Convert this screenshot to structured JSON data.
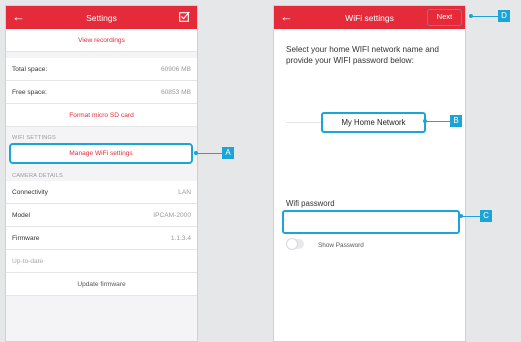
{
  "settings_screen": {
    "title": "Settings",
    "view_recordings": "View recordings",
    "total_space_label": "Total space:",
    "total_space_value": "60906 MB",
    "free_space_label": "Free space:",
    "free_space_value": "60853 MB",
    "format_sd": "Format micro SD card",
    "wifi_section": "WIFI SETTINGS",
    "manage_wifi": "Manage WiFi settings",
    "camera_section": "CAMERA DETAILS",
    "connectivity_label": "Connectivity",
    "connectivity_value": "LAN",
    "model_label": "Model",
    "model_value": "IPCAM-2000",
    "firmware_label": "Firmware",
    "firmware_value": "1.1.3.4",
    "up_to_date": "Up-to-date",
    "update_firmware": "Update firmware"
  },
  "wifi_screen": {
    "title": "WiFi settings",
    "next": "Next",
    "instructions": "Select your home WIFI network name and provide your WIFI password below:",
    "network_name": "My Home Network",
    "password_label": "Wifi password",
    "password_value": "",
    "show_password": "Show Password",
    "show_password_on": false
  },
  "callouts": {
    "a": "A",
    "b": "B",
    "c": "C",
    "d": "D"
  },
  "colors": {
    "accent": "#e52b3a",
    "callout": "#1aa4d8"
  }
}
